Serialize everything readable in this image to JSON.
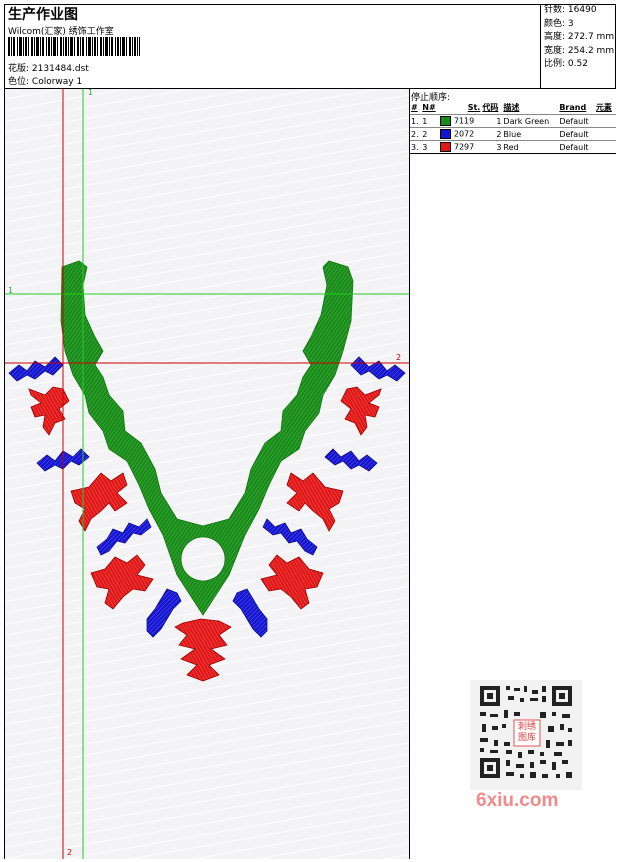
{
  "header": {
    "title": "生产作业图",
    "subtitle": "Wilcom(汇家) 绣饰工作室",
    "design_label": "花版:",
    "design_value": "2131484.dst",
    "colorway_label": "色位:",
    "colorway_value": "Colorway 1"
  },
  "stats": {
    "stitches_label": "针数:",
    "stitches_value": "16490",
    "colors_label": "颜色:",
    "colors_value": "3",
    "height_label": "高度:",
    "height_value": "272.7 mm",
    "width_label": "宽度:",
    "width_value": "254.2 mm",
    "scale_label": "比例:",
    "scale_value": "0.52"
  },
  "stop_sequence": {
    "title": "停止顺序:",
    "headers": [
      "#",
      "N#",
      "St.",
      "代码",
      "描述",
      "Brand",
      "元素"
    ],
    "rows": [
      {
        "index": "1.",
        "n": "1",
        "color": "#1a8a1a",
        "st": "7119",
        "code": "1",
        "desc": "Dark Green",
        "brand": "Default"
      },
      {
        "index": "2.",
        "n": "2",
        "color": "#1515d0",
        "st": "2072",
        "code": "2",
        "desc": "Blue",
        "brand": "Default"
      },
      {
        "index": "3.",
        "n": "3",
        "color": "#e01818",
        "st": "7297",
        "code": "3",
        "desc": "Red",
        "brand": "Default"
      }
    ]
  },
  "guides": {
    "green_v": "1",
    "green_h": "1",
    "red_h": "2",
    "red_v": "2"
  },
  "watermark": {
    "qr_center_text": "刺绣图库",
    "site": "6xiu.com"
  },
  "colors": {
    "green": "#1a8a1a",
    "blue": "#1515d0",
    "red": "#e01818",
    "guide_green": "#22cc22",
    "guide_red": "#cc0000"
  }
}
